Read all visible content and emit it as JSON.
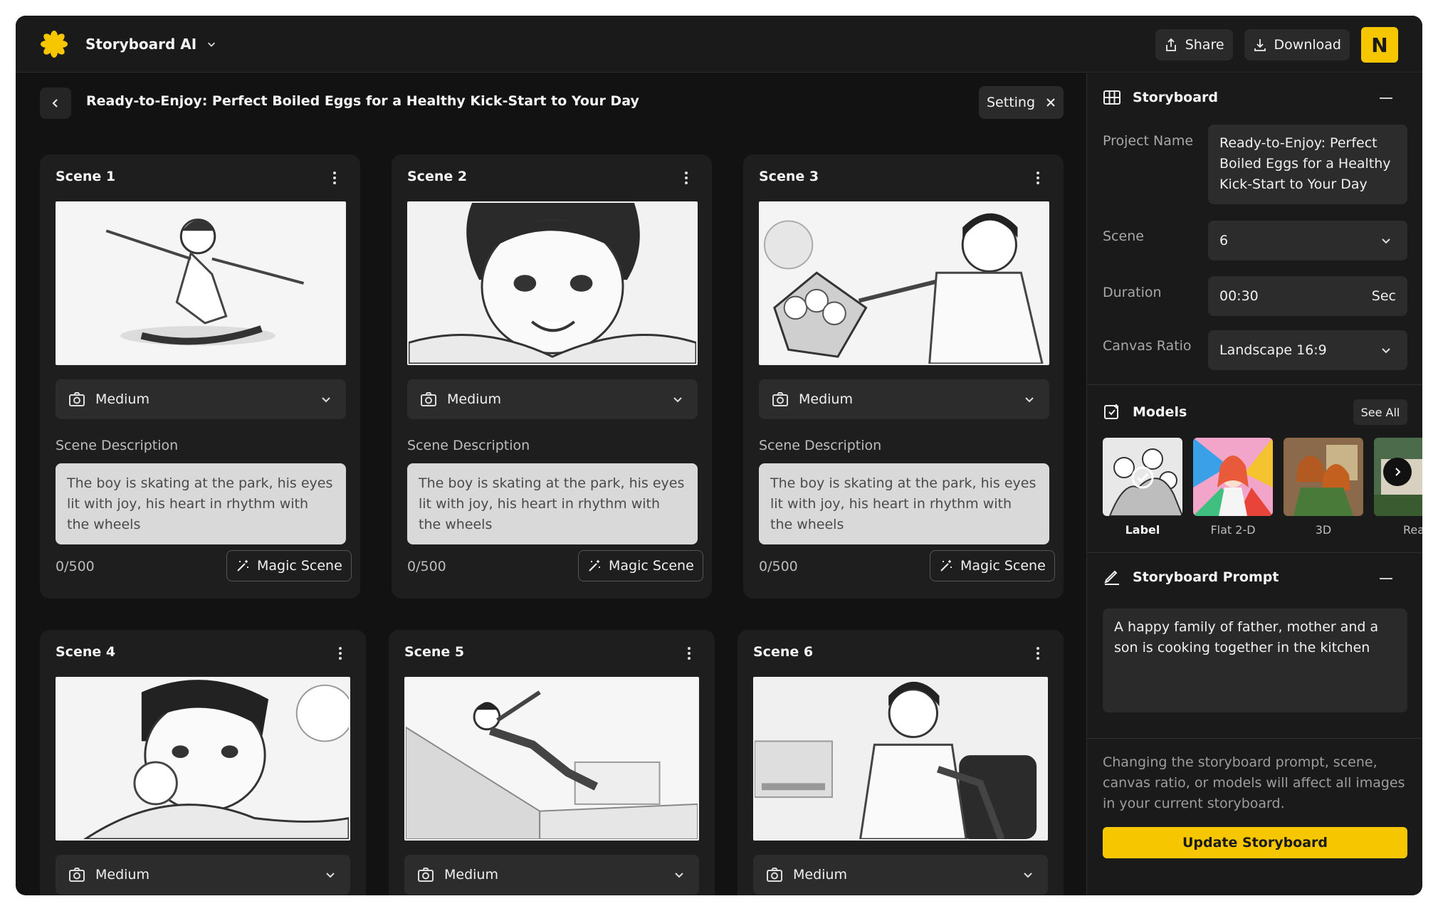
{
  "app": {
    "name": "Storyboard AI",
    "share_label": "Share",
    "download_label": "Download",
    "avatar_initial": "N",
    "accent_color": "#f6c700"
  },
  "page": {
    "title": "Ready-to-Enjoy: Perfect Boiled Eggs for a Healthy Kick-Start to Your Day",
    "setting_label": "Setting"
  },
  "scenes": [
    {
      "title": "Scene 1",
      "shot": "Medium",
      "desc_label": "Scene Description",
      "description": "The boy is skating at the park, his eyes lit with joy, his heart in rhythm with the wheels",
      "counter": "0/500",
      "magic_label": "Magic Scene"
    },
    {
      "title": "Scene 2",
      "shot": "Medium",
      "desc_label": "Scene Description",
      "description": "The boy is skating at the park, his eyes lit with joy, his heart in rhythm with the wheels",
      "counter": "0/500",
      "magic_label": "Magic Scene"
    },
    {
      "title": "Scene 3",
      "shot": "Medium",
      "desc_label": "Scene Description",
      "description": "The boy is skating at the park, his eyes lit with joy, his heart in rhythm with the wheels",
      "counter": "0/500",
      "magic_label": "Magic Scene"
    },
    {
      "title": "Scene 4",
      "shot": "Medium"
    },
    {
      "title": "Scene 5",
      "shot": "Medium"
    },
    {
      "title": "Scene 6",
      "shot": "Medium"
    }
  ],
  "storyboard": {
    "heading": "Storyboard",
    "project_name_label": "Project Name",
    "project_name": "Ready-to-Enjoy: Perfect Boiled Eggs for a Healthy Kick-Start to Your Day",
    "scene_label": "Scene",
    "scene_value": "6",
    "duration_label": "Duration",
    "duration_value": "00:30",
    "duration_unit": "Sec",
    "ratio_label": "Canvas Ratio",
    "ratio_value": "Landscape 16:9"
  },
  "models": {
    "heading": "Models",
    "see_all_label": "See All",
    "items": [
      {
        "label": "Label",
        "selected": true
      },
      {
        "label": "Flat 2-D",
        "selected": false
      },
      {
        "label": "3D",
        "selected": false
      },
      {
        "label": "Rea",
        "selected": false
      }
    ]
  },
  "prompt": {
    "heading": "Storyboard Prompt",
    "text": "A happy family of father, mother and a son is cooking together in the kitchen"
  },
  "note": "Changing the storyboard prompt, scene, canvas ratio, or models will affect all images in your current storyboard.",
  "update_label": "Update Storyboard",
  "icons": [
    "flower-logo-icon",
    "chevron-down-icon",
    "share-icon",
    "download-icon",
    "chevron-left-icon",
    "close-icon",
    "more-vertical-icon",
    "camera-icon",
    "magic-wand-icon",
    "grid-icon",
    "collapse-icon",
    "models-icon",
    "check-circle-icon",
    "chevron-right-icon",
    "edit-icon"
  ]
}
